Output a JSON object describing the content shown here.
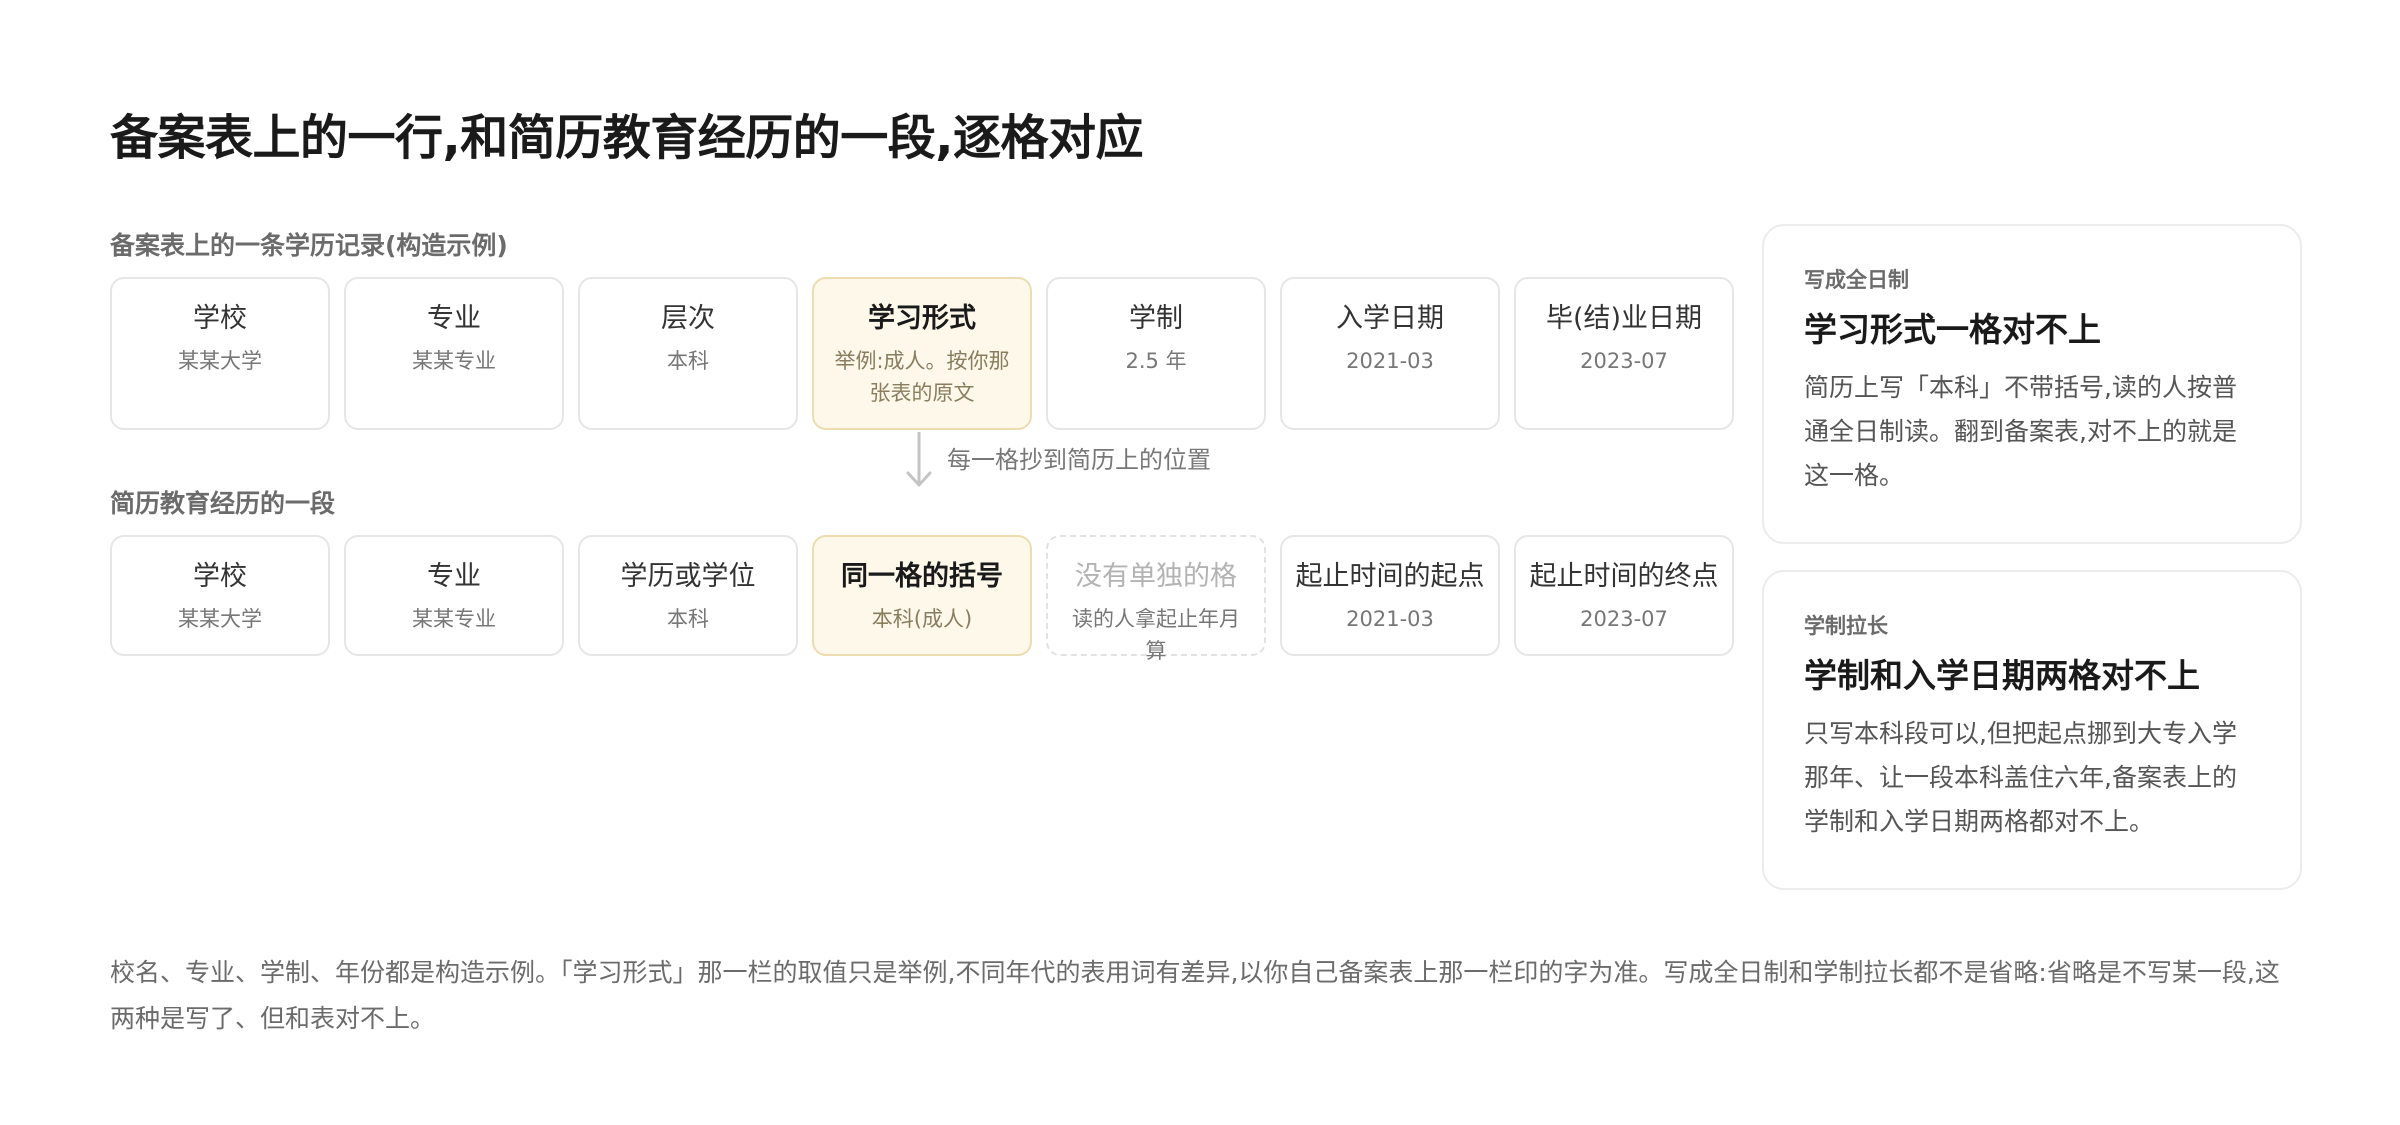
{
  "title": "备案表上的一行,和简历教育经历的一段,逐格对应",
  "record_section": {
    "label": "备案表上的一条学历记录(构造示例)",
    "cells": [
      {
        "title": "学校",
        "sub": "某某大学"
      },
      {
        "title": "专业",
        "sub": "某某专业"
      },
      {
        "title": "层次",
        "sub": "本科"
      },
      {
        "title": "学习形式",
        "sub": "举例:成人。按你那张表的原文"
      },
      {
        "title": "学制",
        "sub": "2.5 年"
      },
      {
        "title": "入学日期",
        "sub": "2021-03"
      },
      {
        "title": "毕(结)业日期",
        "sub": "2023-07"
      }
    ]
  },
  "connector_text": "每一格抄到简历上的位置",
  "resume_section": {
    "label": "简历教育经历的一段",
    "cells": [
      {
        "title": "学校",
        "sub": "某某大学"
      },
      {
        "title": "专业",
        "sub": "某某专业"
      },
      {
        "title": "学历或学位",
        "sub": "本科"
      },
      {
        "title": "同一格的括号",
        "sub": "本科(成人)"
      },
      {
        "title": "没有单独的格",
        "sub": "读的人拿起止年月算"
      },
      {
        "title": "起止时间的起点",
        "sub": "2021-03"
      },
      {
        "title": "起止时间的终点",
        "sub": "2023-07"
      }
    ]
  },
  "cards": [
    {
      "tag": "写成全日制",
      "heading": "学习形式一格对不上",
      "body": "简历上写「本科」不带括号,读的人按普通全日制读。翻到备案表,对不上的就是这一格。"
    },
    {
      "tag": "学制拉长",
      "heading": "学制和入学日期两格对不上",
      "body": "只写本科段可以,但把起点挪到大专入学那年、让一段本科盖住六年,备案表上的学制和入学日期两格都对不上。"
    }
  ],
  "footnote": "校名、专业、学制、年份都是构造示例。「学习形式」那一栏的取值只是举例,不同年代的表用词有差异,以你自己备案表上那一栏印的字为准。写成全日制和学制拉长都不是省略:省略是不写某一段,这两种是写了、但和表对不上。",
  "colors": {
    "highlight_fill": "#fdf8ea",
    "highlight_border": "#ecdcaf",
    "border": "#e6e6e6",
    "muted_text": "#6b6b6b"
  },
  "icons": {
    "connector": "arrow-down-icon"
  }
}
